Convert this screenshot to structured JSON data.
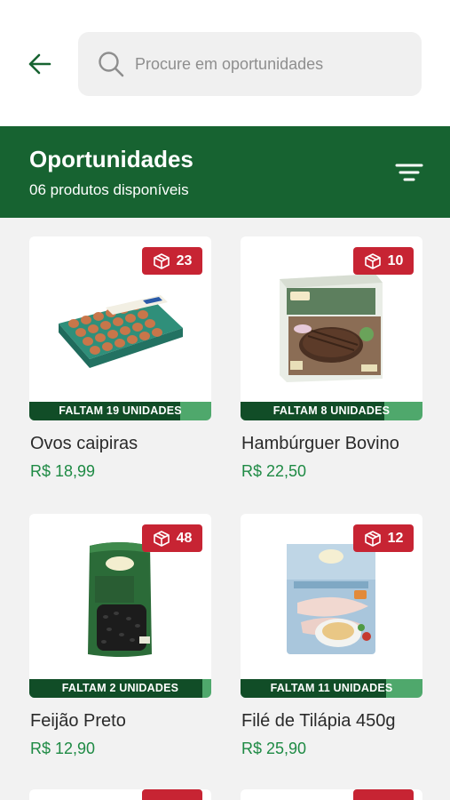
{
  "search": {
    "placeholder": "Procure em oportunidades"
  },
  "banner": {
    "title": "Oportunidades",
    "subtitle": "06 produtos disponíveis"
  },
  "colors": {
    "primary_green": "#176331",
    "price_green": "#1e8a44",
    "badge_red": "#c72433",
    "stripe_dark": "#114d27",
    "stripe_light": "#4fa86c"
  },
  "products": [
    {
      "name": "Ovos caipiras",
      "price": "R$ 18,99",
      "badge_count": "23",
      "remaining_label": "FALTAM 19 UNIDADES",
      "progress": 0.83
    },
    {
      "name": "Hambúrguer Bovino",
      "price": "R$ 22,50",
      "badge_count": "10",
      "remaining_label": "FALTAM 8 UNIDADES",
      "progress": 0.79
    },
    {
      "name": "Feijão Preto",
      "price": "R$ 12,90",
      "badge_count": "48",
      "remaining_label": "FALTAM 2 UNIDADES",
      "progress": 0.95
    },
    {
      "name": "Filé de Tilápia 450g",
      "price": "R$ 25,90",
      "badge_count": "12",
      "remaining_label": "FALTAM 11 UNIDADES",
      "progress": 0.8
    }
  ],
  "icons": {
    "back": "arrow-left-icon",
    "search": "search-icon",
    "filter": "filter-icon",
    "box": "box-icon"
  }
}
